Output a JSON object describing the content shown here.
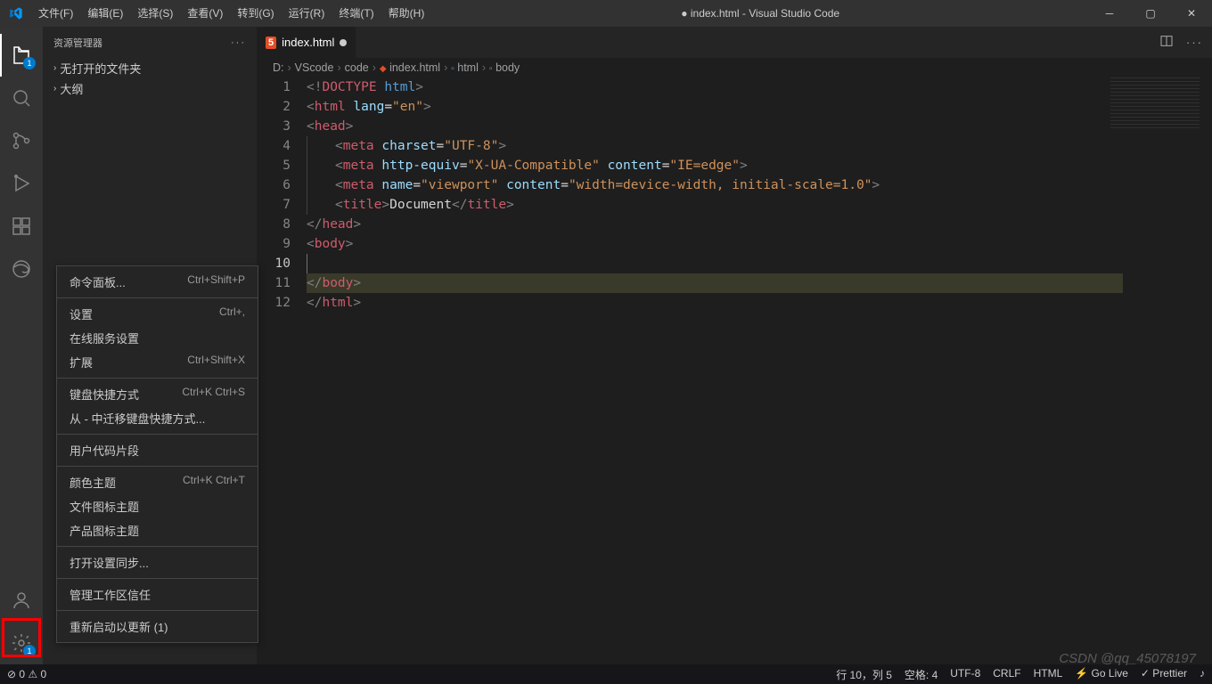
{
  "titlebar": {
    "menus": [
      "文件(F)",
      "编辑(E)",
      "选择(S)",
      "查看(V)",
      "转到(G)",
      "运行(R)",
      "终端(T)",
      "帮助(H)"
    ],
    "title": "● index.html - Visual Studio Code"
  },
  "sidebar": {
    "title": "资源管理器",
    "sections": [
      "无打开的文件夹",
      "大纲"
    ]
  },
  "activity_badge": "1",
  "tab": {
    "label": "index.html"
  },
  "breadcrumbs": [
    "D:",
    "VScode",
    "code",
    "index.html",
    "html",
    "body"
  ],
  "codeLines": [
    {
      "n": 1,
      "html": "<span class='tok-angle'>&lt;!</span><span class='tok-doc-red'>DOCTYPE</span> <span class='tok-doctype'>html</span><span class='tok-angle'>&gt;</span>"
    },
    {
      "n": 2,
      "html": "<span class='tok-angle'>&lt;</span><span class='tok-tag'>html</span> <span class='tok-attr'>lang</span><span class='tok-eq'>=</span><span class='tok-str'>\"en\"</span><span class='tok-angle'>&gt;</span>"
    },
    {
      "n": 3,
      "html": "<span class='tok-angle'>&lt;</span><span class='tok-tag'>head</span><span class='tok-angle'>&gt;</span>"
    },
    {
      "n": 4,
      "indent": 1,
      "html": "<span class='tok-angle'>&lt;</span><span class='tok-tag'>meta</span> <span class='tok-attr'>charset</span><span class='tok-eq'>=</span><span class='tok-str'>\"UTF-8\"</span><span class='tok-angle'>&gt;</span>"
    },
    {
      "n": 5,
      "indent": 1,
      "html": "<span class='tok-angle'>&lt;</span><span class='tok-tag'>meta</span> <span class='tok-attr'>http-equiv</span><span class='tok-eq'>=</span><span class='tok-str'>\"X-UA-Compatible\"</span> <span class='tok-attr'>content</span><span class='tok-eq'>=</span><span class='tok-str'>\"IE=edge\"</span><span class='tok-angle'>&gt;</span>"
    },
    {
      "n": 6,
      "indent": 1,
      "html": "<span class='tok-angle'>&lt;</span><span class='tok-tag'>meta</span> <span class='tok-attr'>name</span><span class='tok-eq'>=</span><span class='tok-str'>\"viewport\"</span> <span class='tok-attr'>content</span><span class='tok-eq'>=</span><span class='tok-str'>\"width=device-width, initial-scale=1.0\"</span><span class='tok-angle'>&gt;</span>"
    },
    {
      "n": 7,
      "indent": 1,
      "html": "<span class='tok-angle'>&lt;</span><span class='tok-tag'>title</span><span class='tok-angle'>&gt;</span><span class='tok-text'>Document</span><span class='tok-angle'>&lt;/</span><span class='tok-tag'>title</span><span class='tok-angle'>&gt;</span>"
    },
    {
      "n": 8,
      "html": "<span class='tok-angle'>&lt;/</span><span class='tok-tag'>head</span><span class='tok-angle'>&gt;</span>"
    },
    {
      "n": 9,
      "html": "<span class='tok-angle'>&lt;</span><span class='tok-tag'>body</span><span class='tok-angle'>&gt;</span>"
    },
    {
      "n": 10,
      "indent": 1,
      "html": "",
      "active": true
    },
    {
      "n": 11,
      "html": "<span class='tok-angle'>&lt;/</span><span class='tok-tag'>body</span><span class='tok-angle'>&gt;</span>"
    },
    {
      "n": 12,
      "html": "<span class='tok-angle'>&lt;/</span><span class='tok-tag'>html</span><span class='tok-angle'>&gt;</span>"
    }
  ],
  "contextMenu": [
    {
      "label": "命令面板...",
      "kbd": "Ctrl+Shift+P"
    },
    {
      "sep": true
    },
    {
      "label": "设置",
      "kbd": "Ctrl+,"
    },
    {
      "label": "在线服务设置"
    },
    {
      "label": "扩展",
      "kbd": "Ctrl+Shift+X"
    },
    {
      "sep": true
    },
    {
      "label": "键盘快捷方式",
      "kbd": "Ctrl+K Ctrl+S"
    },
    {
      "label": "从 - 中迁移键盘快捷方式..."
    },
    {
      "sep": true
    },
    {
      "label": "用户代码片段"
    },
    {
      "sep": true
    },
    {
      "label": "颜色主题",
      "kbd": "Ctrl+K Ctrl+T"
    },
    {
      "label": "文件图标主题"
    },
    {
      "label": "产品图标主题"
    },
    {
      "sep": true
    },
    {
      "label": "打开设置同步..."
    },
    {
      "sep": true
    },
    {
      "label": "管理工作区信任"
    },
    {
      "sep": true
    },
    {
      "label": "重新启动以更新 (1)"
    }
  ],
  "status": {
    "left": [
      "⊘ 0 ⚠ 0"
    ],
    "right": [
      "行 10，列 5",
      "空格: 4",
      "UTF-8",
      "CRLF",
      "HTML",
      "⚡ Go Live",
      "✓ Prettier",
      "♪"
    ]
  },
  "watermark": "CSDN @qq_45078197"
}
